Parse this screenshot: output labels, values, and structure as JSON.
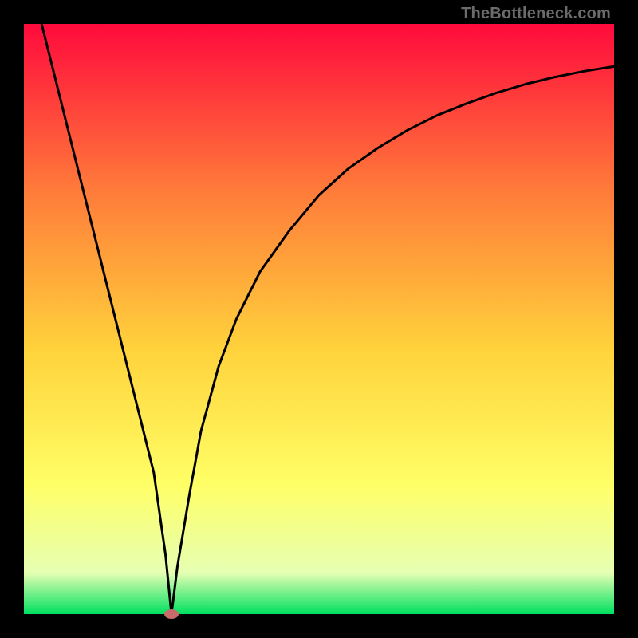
{
  "watermark": "TheBottleneck.com",
  "chart_data": {
    "type": "line",
    "title": "",
    "xlabel": "",
    "ylabel": "",
    "xlim": [
      0,
      100
    ],
    "ylim": [
      0,
      100
    ],
    "grid": false,
    "legend": false,
    "background_gradient": {
      "top": "#ff0a3c",
      "mid_upper": "#ff7a3a",
      "mid": "#ffd23b",
      "mid_lower": "#ffff66",
      "near_bottom": "#e6ffb3",
      "bottom": "#00e060"
    },
    "series": [
      {
        "name": "bottleneck-curve",
        "color": "#000000",
        "x": [
          3,
          6,
          10,
          14,
          18,
          20,
          22,
          24,
          25,
          26,
          28,
          30,
          33,
          36,
          40,
          45,
          50,
          55,
          60,
          65,
          70,
          75,
          80,
          85,
          90,
          95,
          100
        ],
        "y": [
          100,
          88,
          72,
          56,
          40,
          32,
          24,
          10,
          0,
          8,
          20,
          31,
          42,
          50,
          58,
          65,
          71,
          75.5,
          79,
          82,
          84.5,
          86.5,
          88.3,
          89.8,
          91,
          92,
          92.8
        ]
      }
    ],
    "marker": {
      "x": 25,
      "y": 0,
      "color": "#c96b6b"
    }
  }
}
